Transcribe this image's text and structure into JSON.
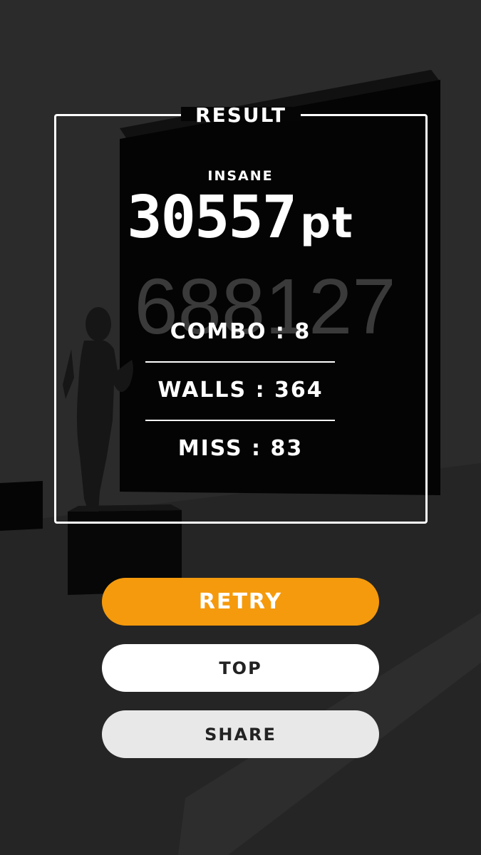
{
  "result": {
    "title": "RESULT",
    "difficulty": "INSANE",
    "score": "30557",
    "score_unit": "pt",
    "background_number": "688127",
    "combo": "COMBO : 8",
    "walls": "WALLS : 364",
    "miss": "MISS : 83"
  },
  "buttons": {
    "retry": "RETRY",
    "top": "TOP",
    "share": "SHARE"
  },
  "colors": {
    "background": "#2b2b2b",
    "wall": "#040404",
    "accent": "#f59a0c",
    "text": "#ffffff"
  }
}
